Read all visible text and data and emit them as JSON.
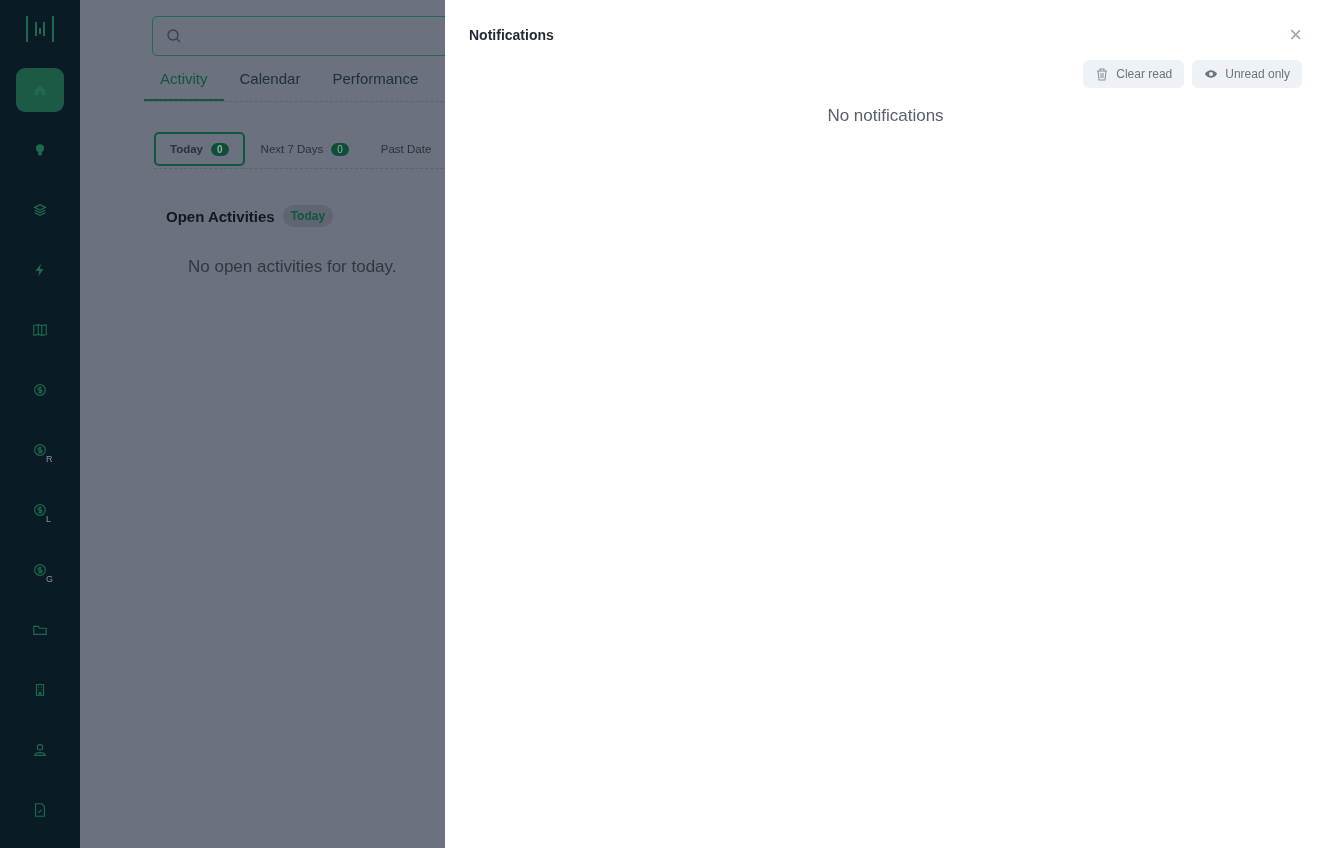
{
  "sidebar": {
    "items": [
      {
        "kind": "home",
        "selected": true
      },
      {
        "kind": "bulb",
        "selected": false
      },
      {
        "kind": "layers",
        "selected": false
      },
      {
        "kind": "bolt",
        "selected": false
      },
      {
        "kind": "book",
        "selected": false
      },
      {
        "kind": "dollar",
        "selected": false
      },
      {
        "kind": "dollar",
        "selected": false,
        "sub": "R"
      },
      {
        "kind": "dollar",
        "selected": false,
        "sub": "L"
      },
      {
        "kind": "dollar",
        "selected": false,
        "sub": "G"
      },
      {
        "kind": "folder",
        "selected": false
      },
      {
        "kind": "building",
        "selected": false
      },
      {
        "kind": "user",
        "selected": false
      },
      {
        "kind": "file",
        "selected": false
      }
    ]
  },
  "tabs": [
    {
      "label": "Activity",
      "selected": true
    },
    {
      "label": "Calendar",
      "selected": false
    },
    {
      "label": "Performance",
      "selected": false
    }
  ],
  "filters": [
    {
      "label": "Today",
      "count": "0",
      "selected": true
    },
    {
      "label": "Next 7 Days",
      "count": "0",
      "selected": false
    },
    {
      "label": "Past Date",
      "selected": false
    }
  ],
  "section": {
    "title": "Open Activities",
    "badge": "Today",
    "empty": "No open activities for today."
  },
  "notifications": {
    "title": "Notifications",
    "close": "×",
    "actions": [
      {
        "kind": "clear",
        "label": "Clear read"
      },
      {
        "kind": "unread",
        "label": "Unread only"
      }
    ],
    "empty": "No notifications"
  }
}
